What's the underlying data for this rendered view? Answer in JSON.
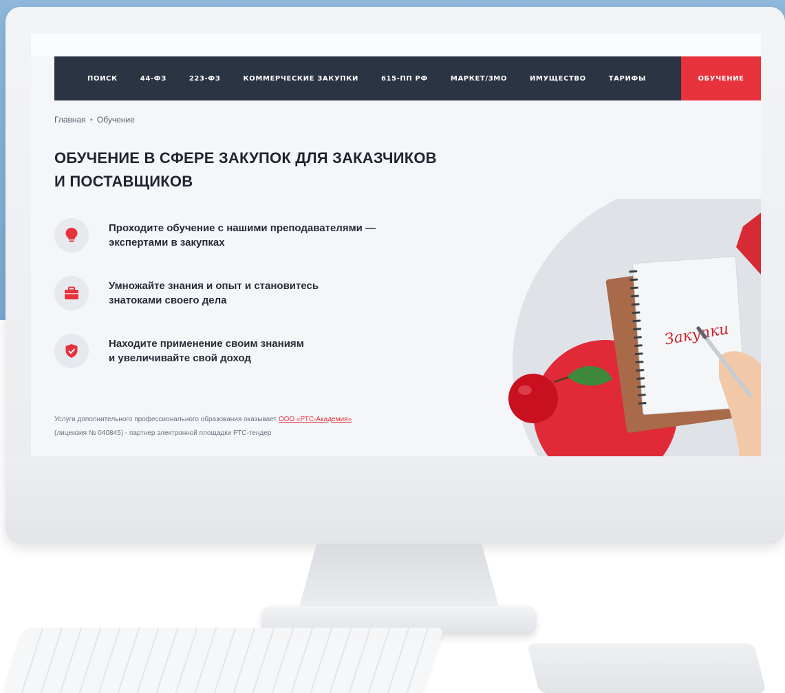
{
  "nav": {
    "items": [
      "ПОИСК",
      "44-ФЗ",
      "223-ФЗ",
      "КОММЕРЧЕСКИЕ ЗАКУПКИ",
      "615-ПП РФ",
      "МАРКЕТ/ЗМО",
      "ИМУЩЕСТВО",
      "ТАРИФЫ"
    ],
    "active": "ОБУЧЕНИЕ"
  },
  "breadcrumb": {
    "home": "Главная",
    "separator": "•",
    "current": "Обучение"
  },
  "page": {
    "title_line1": "ОБУЧЕНИЕ В СФЕРЕ ЗАКУПОК ДЛЯ ЗАКАЗЧИКОВ",
    "title_line2": "И ПОСТАВЩИКОВ"
  },
  "features": [
    {
      "icon": "lightbulb-icon",
      "line1": "Проходите обучение с нашими преподавателями —",
      "line2": "экспертами в закупках"
    },
    {
      "icon": "briefcase-icon",
      "line1": "Умножайте знания и опыт и становитесь",
      "line2": "знатоками своего дела"
    },
    {
      "icon": "shield-check-icon",
      "line1": "Находите применение своим знаниям",
      "line2": "и увеличивайте свой доход"
    }
  ],
  "footnote": {
    "text_before": "Услуги дополнительного профессионального образования оказывает ",
    "link": "ООО «РТС-Академия»",
    "line2": "(лицензия № 040845) - партнер электронной площадки РТС-тендер"
  },
  "illustration": {
    "notebook_text": "Закупки"
  },
  "colors": {
    "accent": "#e8323c",
    "nav_bg": "#2b3442",
    "title": "#1f2530",
    "backdrop": "#8fb8dc"
  }
}
